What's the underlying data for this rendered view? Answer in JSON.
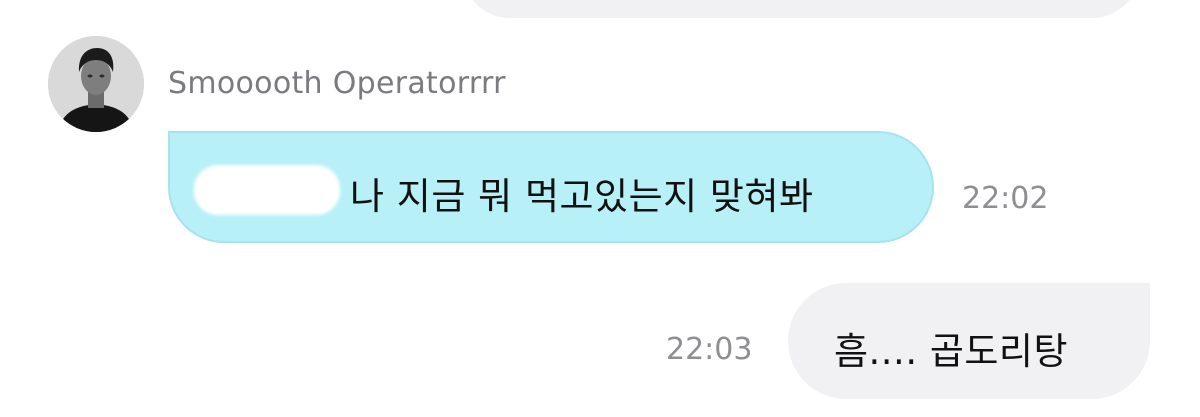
{
  "conversation": {
    "incoming": {
      "sender_name": "Smooooth Operatorrrr",
      "text": "나 지금 뭐 먹고있는지 맞혀봐",
      "time": "22:02",
      "bubble_color": "#b8f0f7"
    },
    "outgoing": {
      "text": "흠.... 곱도리탕",
      "time": "22:03",
      "bubble_color": "#f1f1f4"
    }
  }
}
